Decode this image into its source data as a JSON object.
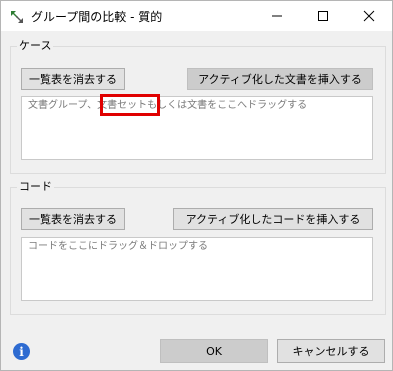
{
  "window": {
    "title": "グループ間の比較 - 質的"
  },
  "cases_group": {
    "label": "ケース",
    "clear_button": "一覧表を消去する",
    "insert_button": "アクティブ化した文書を挿入する",
    "drop_placeholder": "文書グループ、文書セットもしくは文書をここへドラッグする"
  },
  "codes_group": {
    "label": "コード",
    "clear_button": "一覧表を消去する",
    "insert_button": "アクティブ化したコードを挿入する",
    "drop_placeholder": "コードをここにドラッグ＆ドロップする"
  },
  "footer": {
    "ok_button": "OK",
    "cancel_button": "キャンセルする"
  }
}
